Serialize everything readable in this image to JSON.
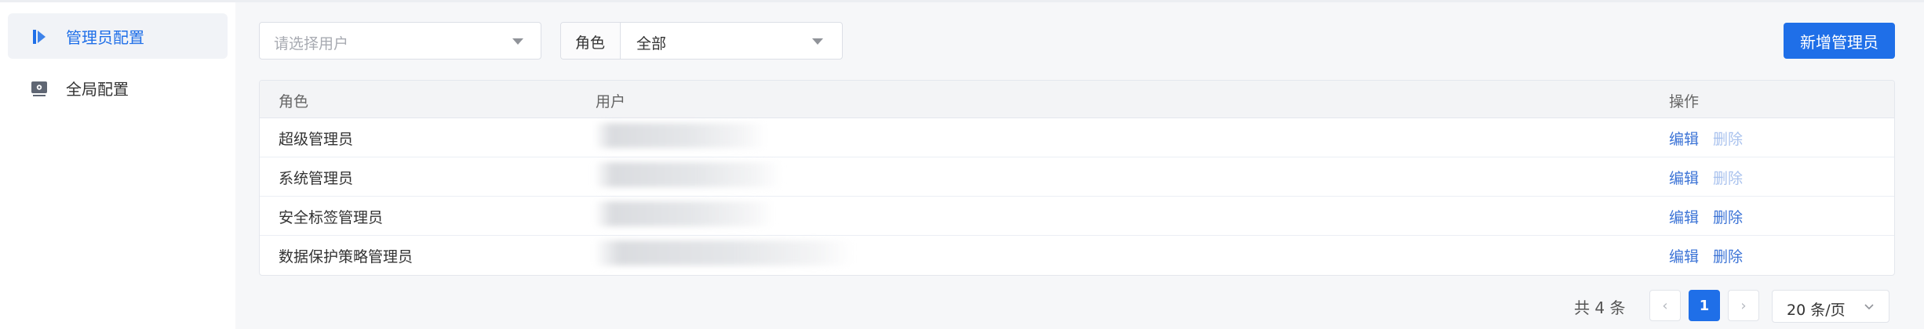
{
  "sidebar": {
    "items": [
      {
        "label": "管理员配置",
        "icon": "admin-config-icon",
        "active": true
      },
      {
        "label": "全局配置",
        "icon": "global-config-icon",
        "active": false
      }
    ]
  },
  "filters": {
    "user_placeholder": "请选择用户",
    "role_label": "角色",
    "role_value": "全部"
  },
  "toolbar": {
    "add_label": "新增管理员"
  },
  "table": {
    "headers": {
      "role": "角色",
      "user": "用户",
      "ops": "操作"
    },
    "rows": [
      {
        "role": "超级管理员",
        "edit": "编辑",
        "delete": "删除",
        "delete_disabled": true
      },
      {
        "role": "系统管理员",
        "edit": "编辑",
        "delete": "删除",
        "delete_disabled": true
      },
      {
        "role": "安全标签管理员",
        "edit": "编辑",
        "delete": "删除",
        "delete_disabled": false
      },
      {
        "role": "数据保护策略管理员",
        "edit": "编辑",
        "delete": "删除",
        "delete_disabled": false
      }
    ]
  },
  "pagination": {
    "total_text": "共 4 条",
    "current_page": "1",
    "prev": "‹",
    "next": "›",
    "page_size": "20 条/页"
  },
  "colors": {
    "primary": "#1f6fe8",
    "link": "#3b73d6",
    "link_disabled": "#a9c2ee"
  }
}
